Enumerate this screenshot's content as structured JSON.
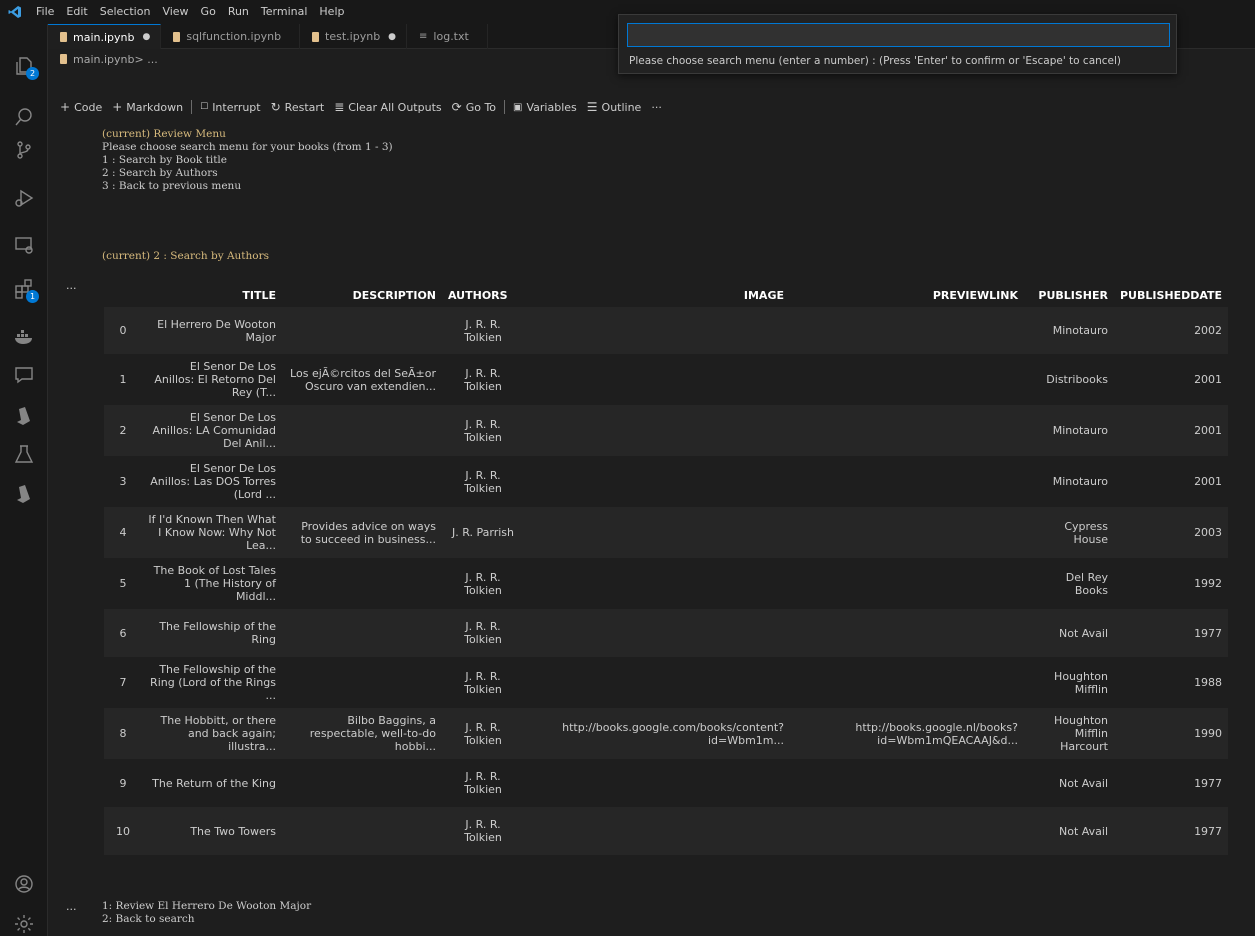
{
  "menubar": {
    "items": [
      "File",
      "Edit",
      "Selection",
      "View",
      "Go",
      "Run",
      "Terminal",
      "Help"
    ]
  },
  "activity": {
    "explorer_badge": "2",
    "extensions_badge": "1"
  },
  "tabs": [
    {
      "label": "main.ipynb",
      "modified": "●"
    },
    {
      "label": "sqlfunction.ipynb",
      "modified": ""
    },
    {
      "label": "test.ipynb",
      "modified": "●"
    },
    {
      "label": "log.txt",
      "modified": ""
    }
  ],
  "breadcrumb": {
    "file": "main.ipynb",
    "rest": " > ..."
  },
  "toolbar": {
    "code": "Code",
    "markdown": "Markdown",
    "interrupt": "Interrupt",
    "restart": "Restart",
    "clear": "Clear All Outputs",
    "goto": "Go To",
    "variables": "Variables",
    "outline": "Outline",
    "more": "···"
  },
  "quickpick": {
    "value": "",
    "message": "Please choose search menu (enter a number) : (Press 'Enter' to confirm or 'Escape' to cancel)"
  },
  "output": {
    "review_menu": {
      "title": "(current) Review Menu",
      "prompt": "Please choose search menu for your books (from 1 - 3)",
      "opt1": "1 : Search by Book title",
      "opt2": "2 : Search by Authors",
      "opt3": "3 : Back to previous menu"
    },
    "current_selection": "(current) 2 : Search by Authors",
    "ellipsis": "···",
    "bottom": {
      "line1": "1: Review  El Herrero De Wooton Major",
      "line2": "2: Back to search"
    }
  },
  "table": {
    "headers": [
      "",
      "TITLE",
      "DESCRIPTION",
      "AUTHORS",
      "IMAGE",
      "PREVIEWLINK",
      "PUBLISHER",
      "PUBLISHEDDATE"
    ],
    "rows": [
      {
        "idx": "0",
        "title": "El Herrero De Wooton Major",
        "desc": "",
        "authors": "J. R. R. Tolkien",
        "image": "",
        "preview": "",
        "publisher": "Minotauro",
        "date": "2002"
      },
      {
        "idx": "1",
        "title": "El Senor De Los Anillos: El Retorno Del Rey (T...",
        "desc": "Los ejÃ©rcitos del SeÃ±or Oscuro van extendien...",
        "authors": "J. R. R. Tolkien",
        "image": "",
        "preview": "",
        "publisher": "Distribooks",
        "date": "2001"
      },
      {
        "idx": "2",
        "title": "El Senor De Los Anillos: LA Comunidad Del Anil...",
        "desc": "",
        "authors": "J. R. R. Tolkien",
        "image": "",
        "preview": "",
        "publisher": "Minotauro",
        "date": "2001"
      },
      {
        "idx": "3",
        "title": "El Senor De Los Anillos: Las DOS Torres (Lord ...",
        "desc": "",
        "authors": "J. R. R. Tolkien",
        "image": "",
        "preview": "",
        "publisher": "Minotauro",
        "date": "2001"
      },
      {
        "idx": "4",
        "title": "If I'd Known Then What I Know Now: Why Not Lea...",
        "desc": "Provides advice on ways to succeed in business...",
        "authors": "J. R. Parrish",
        "image": "",
        "preview": "",
        "publisher": "Cypress House",
        "date": "2003"
      },
      {
        "idx": "5",
        "title": "The Book of Lost Tales 1 (The History of Middl...",
        "desc": "",
        "authors": "J. R. R. Tolkien",
        "image": "",
        "preview": "",
        "publisher": "Del Rey Books",
        "date": "1992"
      },
      {
        "idx": "6",
        "title": "The Fellowship of the Ring",
        "desc": "",
        "authors": "J. R. R. Tolkien",
        "image": "",
        "preview": "",
        "publisher": "Not Avail",
        "date": "1977"
      },
      {
        "idx": "7",
        "title": "The Fellowship of the Ring (Lord of the Rings ...",
        "desc": "",
        "authors": "J. R. R. Tolkien",
        "image": "",
        "preview": "",
        "publisher": "Houghton Mifflin",
        "date": "1988"
      },
      {
        "idx": "8",
        "title": "The Hobbitt, or there and back again; illustra...",
        "desc": "Bilbo Baggins, a respectable, well-to-do hobbi...",
        "authors": "J. R. R. Tolkien",
        "image": "http://books.google.com/books/content?id=Wbm1m...",
        "preview": "http://books.google.nl/books?id=Wbm1mQEACAAJ&d...",
        "publisher": "Houghton Mifflin Harcourt",
        "date": "1990"
      },
      {
        "idx": "9",
        "title": "The Return of the King",
        "desc": "",
        "authors": "J. R. R. Tolkien",
        "image": "",
        "preview": "",
        "publisher": "Not Avail",
        "date": "1977"
      },
      {
        "idx": "10",
        "title": "The Two Towers",
        "desc": "",
        "authors": "J. R. R. Tolkien",
        "image": "",
        "preview": "",
        "publisher": "Not Avail",
        "date": "1977"
      }
    ]
  }
}
